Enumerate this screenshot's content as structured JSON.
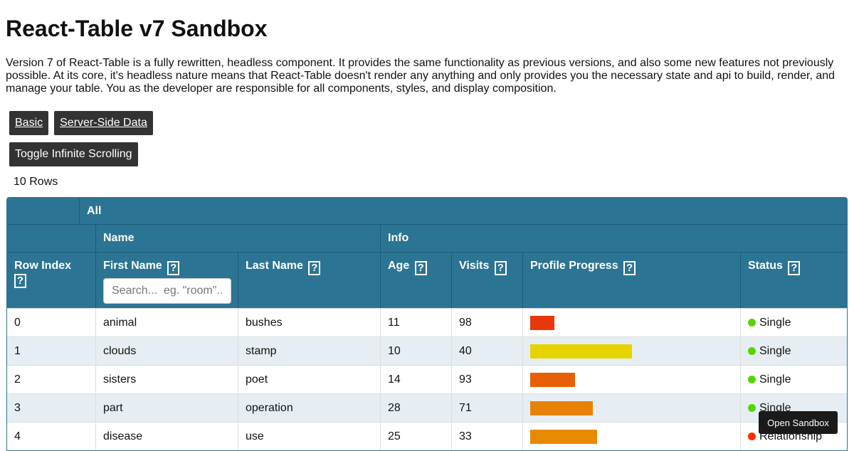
{
  "title": "React-Table v7 Sandbox",
  "intro": "Version 7 of React-Table is a fully rewritten, headless component. It provides the same functionality as previous versions, and also some new features not previously possible. At its core, it's headless nature means that React-Table doesn't render any anything and only provides you the necessary state and api to build, render, and manage your table. You as the developer are responsible for all components, styles, and display composition.",
  "buttons": {
    "basic": "Basic",
    "server": "Server-Side Data",
    "toggle": "Toggle Infinite Scrolling"
  },
  "row_count": "10 Rows",
  "table": {
    "group_all": "All",
    "group_name": "Name",
    "group_info": "Info",
    "help_glyph": "?",
    "columns": [
      "Row Index",
      "First Name",
      "Last Name",
      "Age",
      "Visits",
      "Profile Progress",
      "Status"
    ],
    "search_placeholder": "Search...  eg. \"room\"...",
    "rows": [
      {
        "index": "0",
        "first": "animal",
        "last": "bushes",
        "age": "11",
        "visits": "98",
        "progress": 0.12,
        "progress_color": "#e8380a",
        "status": "Single",
        "status_color": "#57d500"
      },
      {
        "index": "1",
        "first": "clouds",
        "last": "stamp",
        "age": "10",
        "visits": "40",
        "progress": 0.5,
        "progress_color": "#e7d300",
        "status": "Single",
        "status_color": "#57d500"
      },
      {
        "index": "2",
        "first": "sisters",
        "last": "poet",
        "age": "14",
        "visits": "93",
        "progress": 0.22,
        "progress_color": "#e85f05",
        "status": "Single",
        "status_color": "#57d500"
      },
      {
        "index": "3",
        "first": "part",
        "last": "operation",
        "age": "28",
        "visits": "71",
        "progress": 0.31,
        "progress_color": "#e88205",
        "status": "Single",
        "status_color": "#57d500"
      },
      {
        "index": "4",
        "first": "disease",
        "last": "use",
        "age": "25",
        "visits": "33",
        "progress": 0.33,
        "progress_color": "#e88a00",
        "status": "Relationship",
        "status_color": "#ff2e00"
      }
    ]
  },
  "tooltip": "Open Sandbox",
  "colors": {
    "header": "#2c7493",
    "alt_row": "#e6eef4",
    "button": "#333333"
  }
}
